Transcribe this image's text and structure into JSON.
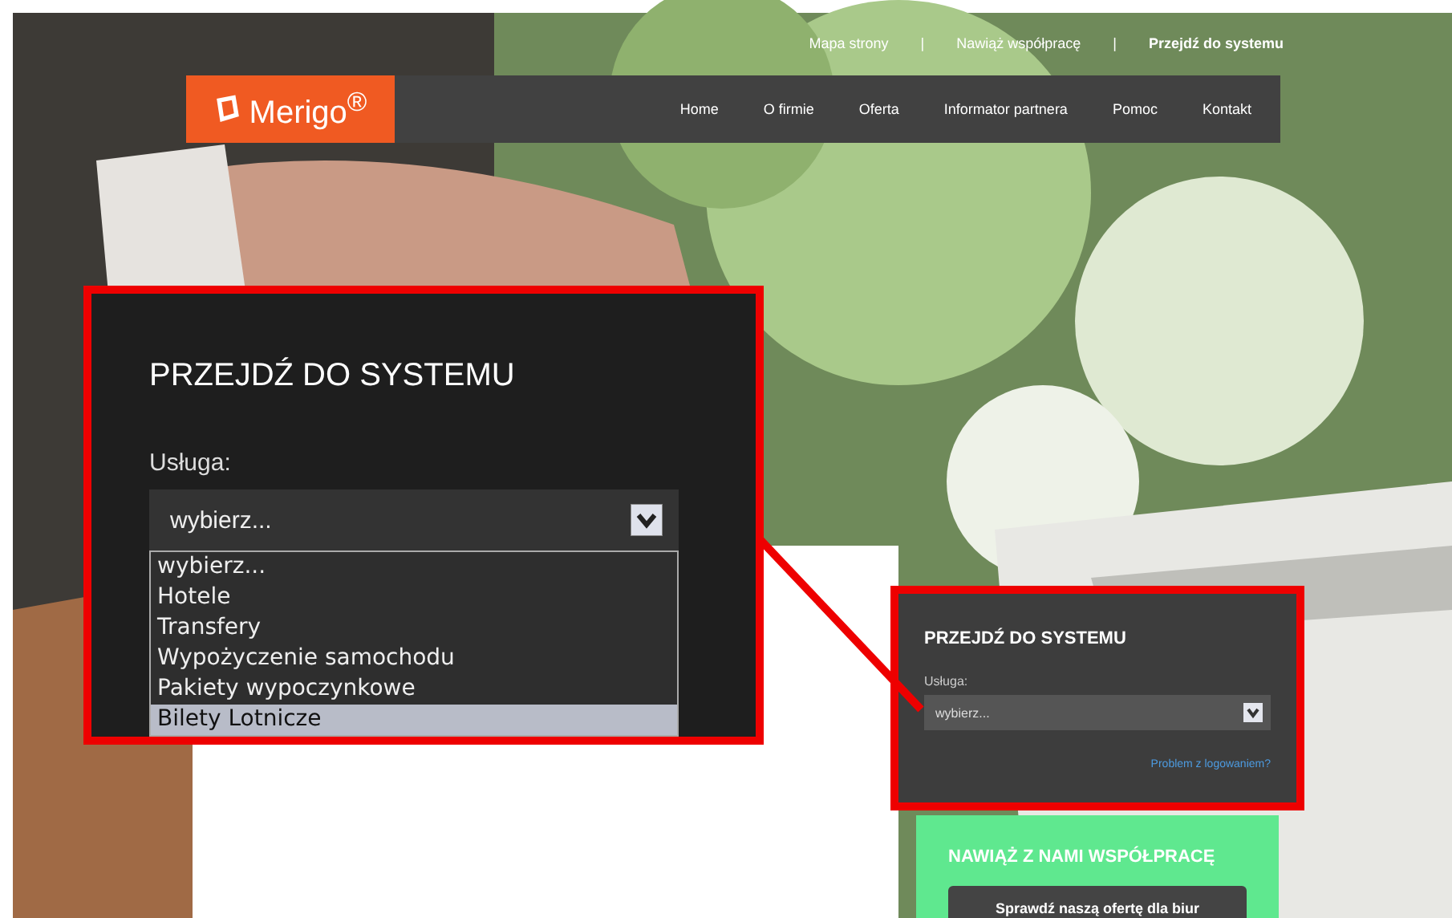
{
  "top_links": [
    {
      "label": "Mapa strony",
      "selected": false
    },
    {
      "label": "Nawiąż współpracę",
      "selected": false
    },
    {
      "label": "Przejdź do systemu",
      "selected": true
    }
  ],
  "separator": "|",
  "logo": "Merigo$^{®}$",
  "nav": [
    "Home",
    "O firmie",
    "Oferta",
    "Informator partnera",
    "Pomoc",
    "Kontakt"
  ],
  "callout": {
    "title": "PRZEJDŹ DO SYSTEMU",
    "label": "Usługa:",
    "value": "wybierz...",
    "options": [
      {
        "label": "wybierz...",
        "highlighted": false
      },
      {
        "label": "Hotele",
        "highlighted": false
      },
      {
        "label": "Transfery",
        "highlighted": false
      },
      {
        "label": "Wypożyczenie samochodu",
        "highlighted": false
      },
      {
        "label": "Pakiety wypoczynkowe",
        "highlighted": false
      },
      {
        "label": "Bilety Lotnicze",
        "highlighted": true
      }
    ]
  },
  "login_panel": {
    "title": "PRZEJDŹ DO SYSTEMU",
    "label": "Usługa:",
    "value": "wybierz...",
    "link": "Problem z logowaniem?"
  },
  "cooperation_panel": {
    "title": "NAWIĄŻ Z NAMI WSPÓŁPRACĘ",
    "button": "Sprawdź naszą ofertę dla biur"
  }
}
